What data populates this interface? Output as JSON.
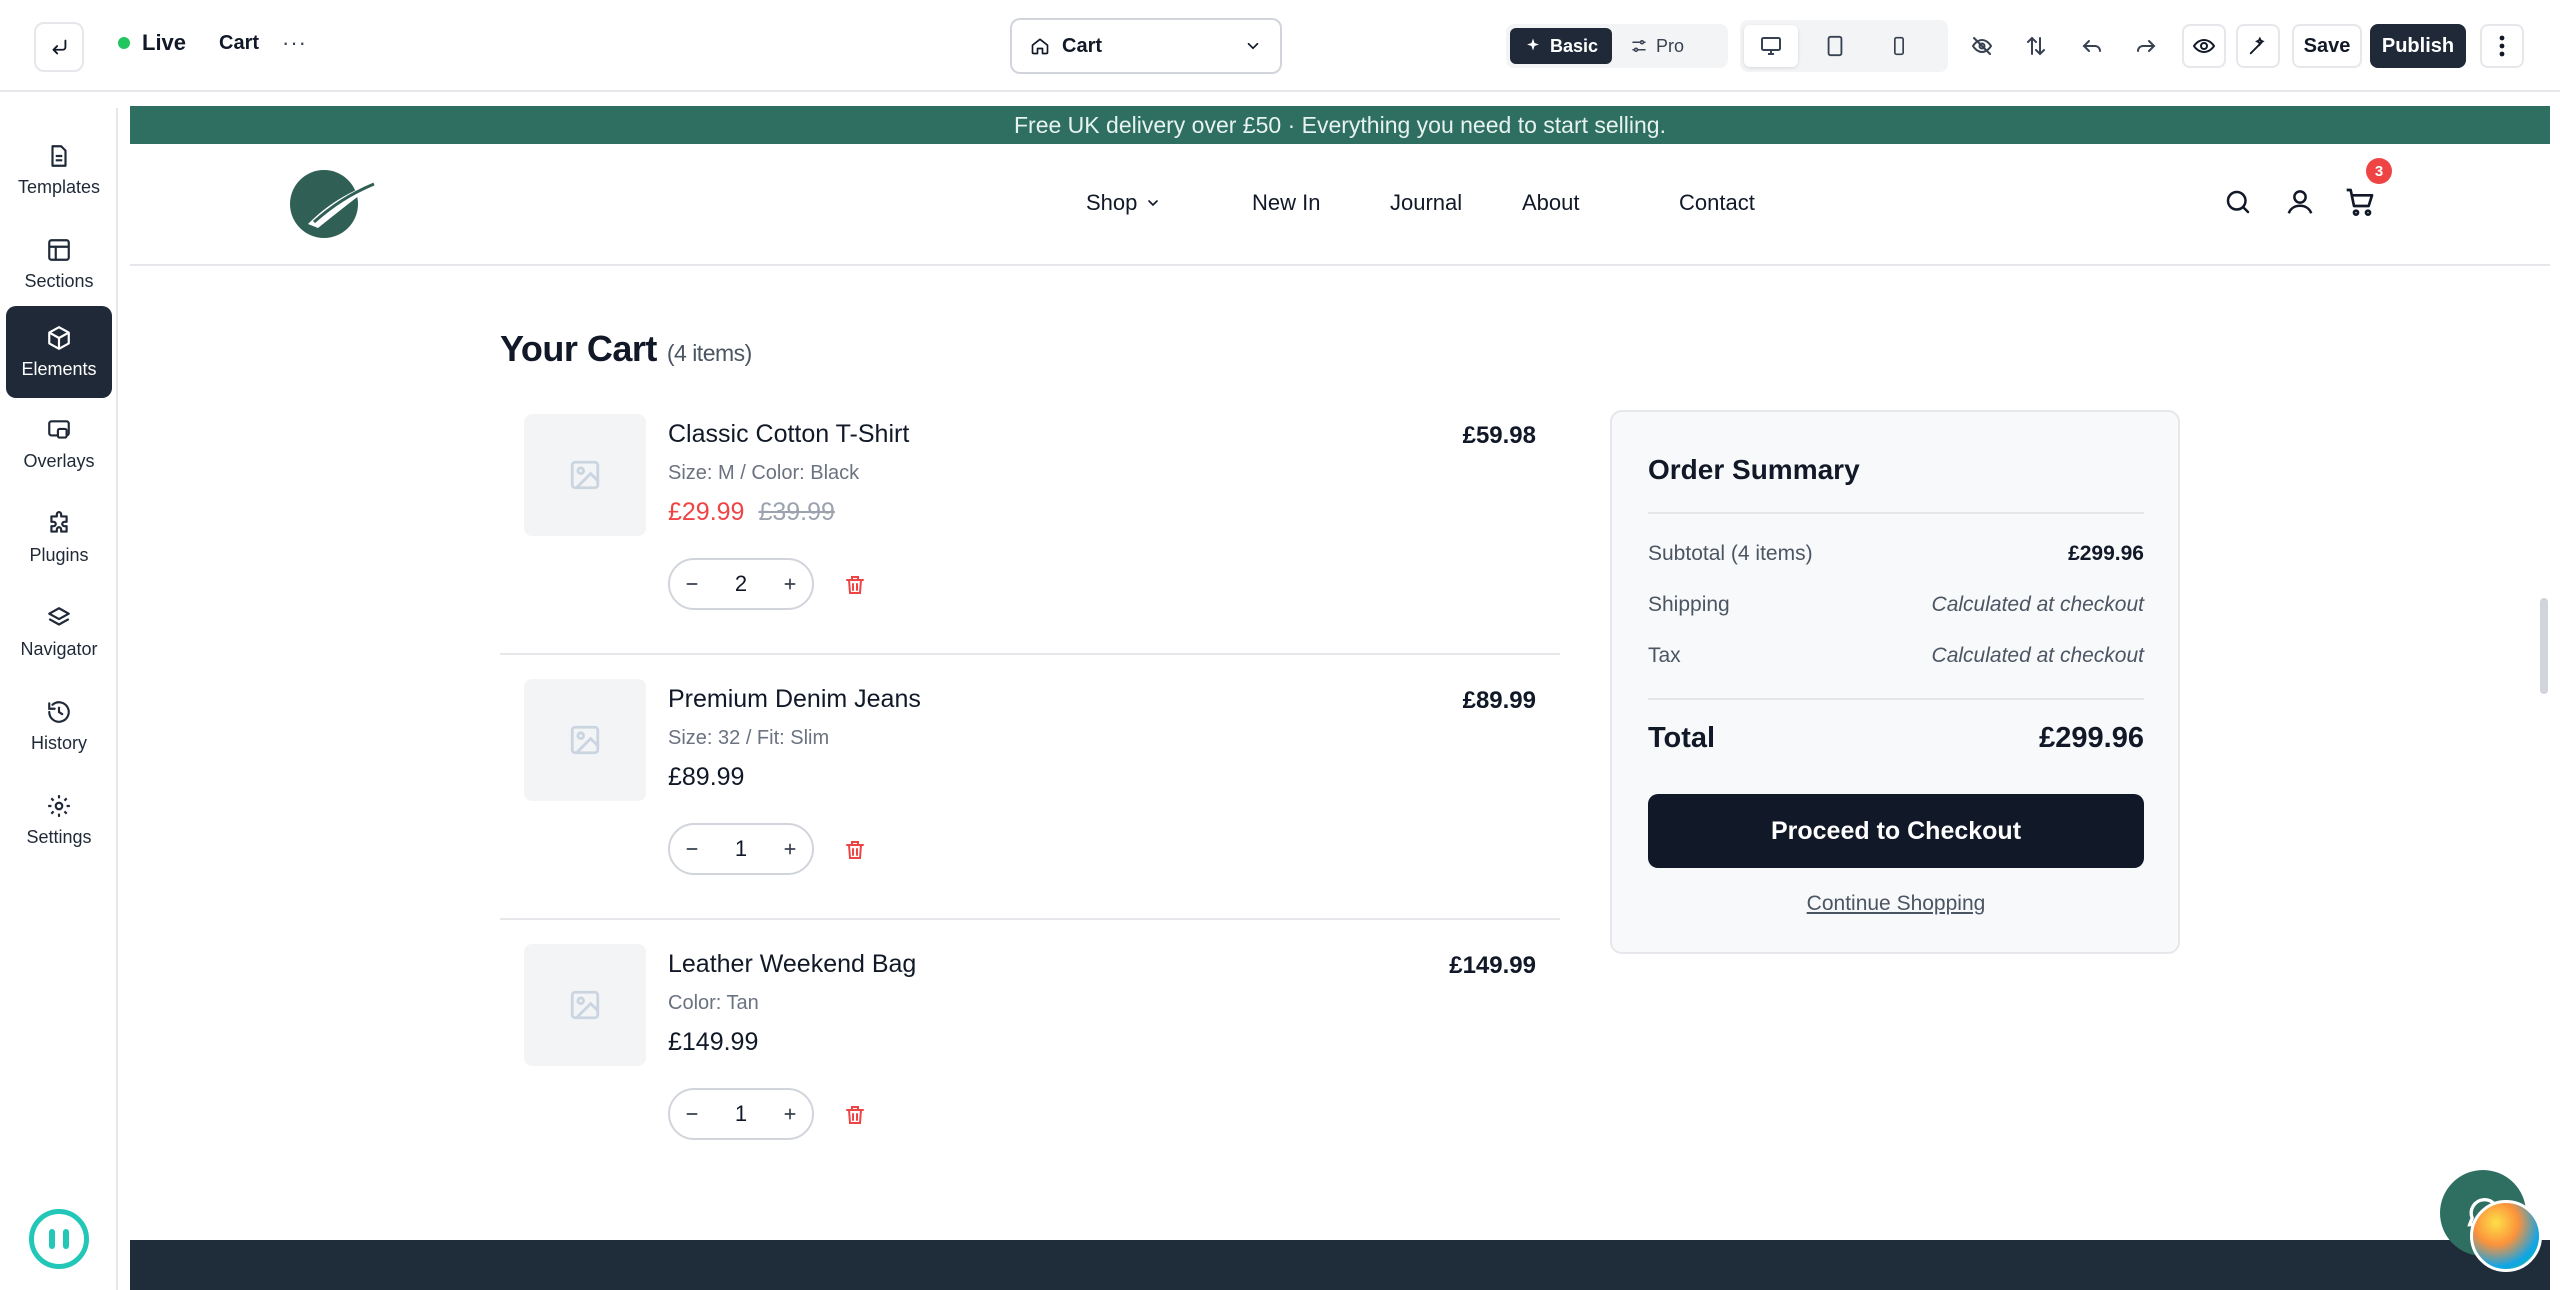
{
  "topbar": {
    "status": "Live",
    "page_name": "Cart",
    "more": "···",
    "page_select": "Cart",
    "mode_basic": "Basic",
    "mode_pro": "Pro",
    "save": "Save",
    "publish": "Publish"
  },
  "sidebar": {
    "items": [
      {
        "label": "Templates",
        "icon": "document-icon"
      },
      {
        "label": "Sections",
        "icon": "layout-icon"
      },
      {
        "label": "Elements",
        "icon": "cube-icon"
      },
      {
        "label": "Overlays",
        "icon": "overlay-icon"
      },
      {
        "label": "Plugins",
        "icon": "puzzle-icon"
      },
      {
        "label": "Navigator",
        "icon": "layers-icon"
      },
      {
        "label": "History",
        "icon": "history-icon"
      },
      {
        "label": "Settings",
        "icon": "gear-icon"
      }
    ],
    "active": "Elements"
  },
  "store": {
    "announcement": "Free UK delivery over £50 · Everything you need to start selling.",
    "nav": [
      "Shop",
      "New In",
      "Journal",
      "About",
      "Contact"
    ],
    "cart_count": "3",
    "brand_color": "#2f6f62"
  },
  "cart": {
    "title": "Your Cart",
    "count": "(4 items)",
    "items": [
      {
        "name": "Classic Cotton T-Shirt",
        "variant": "Size: M / Color: Black",
        "price": "£29.99",
        "original_price": "£39.99",
        "qty": "2",
        "line_total": "£59.98"
      },
      {
        "name": "Premium Denim Jeans",
        "variant": "Size: 32 / Fit: Slim",
        "price": "£89.99",
        "qty": "1",
        "line_total": "£89.99"
      },
      {
        "name": "Leather Weekend Bag",
        "variant": "Color: Tan",
        "price": "£149.99",
        "qty": "1",
        "line_total": "£149.99"
      }
    ]
  },
  "summary": {
    "title": "Order Summary",
    "subtotal_label": "Subtotal (4 items)",
    "subtotal_value": "£299.96",
    "shipping_label": "Shipping",
    "shipping_value": "Calculated at checkout",
    "tax_label": "Tax",
    "tax_value": "Calculated at checkout",
    "total_label": "Total",
    "total_value": "£299.96",
    "checkout": "Proceed to Checkout",
    "continue": "Continue Shopping"
  }
}
